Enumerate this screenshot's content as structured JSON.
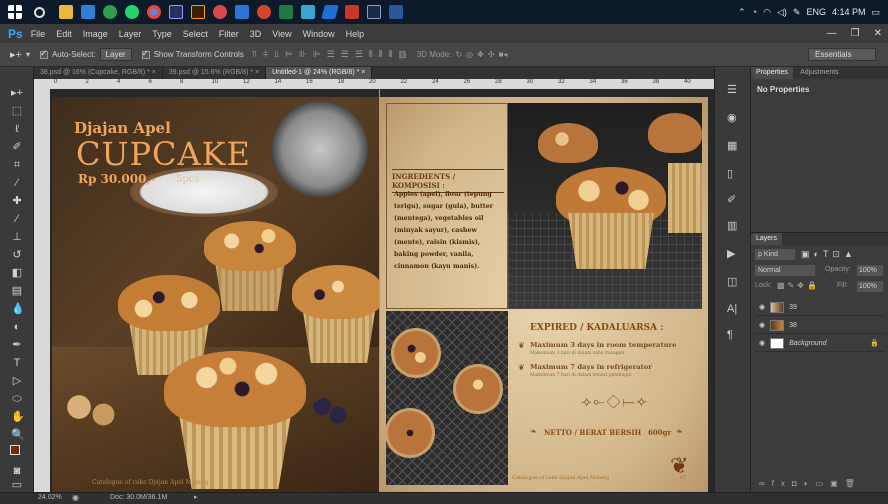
{
  "taskbar": {
    "icons": [
      "windows-icon",
      "search-icon",
      "file-explorer-icon",
      "chrome-icon",
      "whatsapp-icon",
      "chrome-icon-2",
      "premiere-icon",
      "illustrator-icon",
      "photos-icon",
      "app-icon",
      "media-icon",
      "excel-icon",
      "app-icon-2",
      "edit-icon",
      "app-icon-3",
      "app-icon-4",
      "word-icon"
    ],
    "tray_lang": "ENG",
    "clock_time": "4:14 PM"
  },
  "menubar": {
    "logo": "Ps",
    "items": [
      "File",
      "Edit",
      "Image",
      "Layer",
      "Type",
      "Select",
      "Filter",
      "3D",
      "View",
      "Window",
      "Help"
    ]
  },
  "options": {
    "auto_select_label": "Auto-Select:",
    "auto_select_value": "Layer",
    "show_transform_label": "Show Transform Controls",
    "mode_3d": "3D Mode:",
    "workspace": "Essentials"
  },
  "tabs": [
    {
      "label": "38.psd @ 16% (Cupcake, RGB/8) *",
      "active": false
    },
    {
      "label": "39.psd @ 15.6% (RGB/8) *",
      "active": false
    },
    {
      "label": "Untitled-1 @ 24% (RGB/8) *",
      "active": true
    }
  ],
  "ruler_ticks": [
    "0",
    "2",
    "4",
    "6",
    "8",
    "10",
    "12",
    "14",
    "16",
    "18",
    "20",
    "22",
    "24",
    "26",
    "28",
    "30",
    "32",
    "34",
    "36",
    "38",
    "40"
  ],
  "left_page": {
    "brand": "Djajan Apel",
    "product": "CUPCAKE",
    "price": "Rp 30.000,-",
    "qty": "5pcs",
    "footer": "Catalogue of cake Djajan Apel Malang"
  },
  "right_page": {
    "ingredients_title": "INGREDIENTS / KOMPOSISI :",
    "ingredients_text": "Apples (apel), flour (tepung terigu), sugar (gula), butter (mentega), vegetables oil (minyak sayur), cashew (mente), raisin (kismis), baking powder, vanila, cinnamon (kayu manis).",
    "expired_title": "EXPIRED / KADALUARSA :",
    "exp1_main": "Maximum 3 days in room temperature",
    "exp1_sub": "Maksimum 3 hari di dalam suhu ruangan",
    "exp2_main": "Maximum 7 days in refrigerator",
    "exp2_sub": "Maksimum 7 hari di dalam lemari pendingin",
    "netto_label": "NETTO / BERAT BERSIH",
    "netto_value": "600gr",
    "footer": "Catalogue of cake Djajan Apel Malang",
    "page_no": "07"
  },
  "panels": {
    "properties_tab": "Properties",
    "adjustments_tab": "Adjustments",
    "no_properties": "No Properties",
    "layers_tab": "Layers",
    "kind": "ρ Kind",
    "blend_mode": "Normal",
    "opacity_label": "Opacity:",
    "opacity_value": "100%",
    "lock_label": "Lock:",
    "fill_label": "Fill:",
    "fill_value": "100%",
    "layers": [
      {
        "name": "39"
      },
      {
        "name": "38"
      },
      {
        "name": "Background"
      }
    ]
  },
  "status": {
    "zoom": "24.02%",
    "doc": "Doc: 30.0M/36.1M"
  },
  "colors": {
    "ps_blue": "#31a8ff",
    "canvas_bg": "#282828",
    "guide": "#37c7d9",
    "parchment": "#d8c09a",
    "title_orange": "#f0a55a"
  }
}
